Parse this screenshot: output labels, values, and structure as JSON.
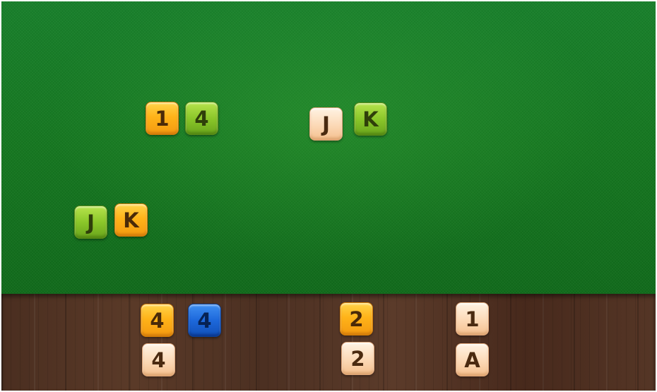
{
  "table": {
    "melds": [
      {
        "tiles": [
          {
            "label": "1",
            "color": "orange"
          },
          {
            "label": "4",
            "color": "green"
          }
        ]
      },
      {
        "tiles": [
          {
            "label": "J",
            "color": "cream"
          },
          {
            "label": "K",
            "color": "green"
          }
        ]
      },
      {
        "tiles": [
          {
            "label": "J",
            "color": "green"
          },
          {
            "label": "K",
            "color": "orange"
          }
        ]
      }
    ]
  },
  "rack": {
    "tiles": [
      {
        "label": "4",
        "color": "orange"
      },
      {
        "label": "4",
        "color": "blue"
      },
      {
        "label": "4",
        "color": "cream"
      },
      {
        "label": "2",
        "color": "orange"
      },
      {
        "label": "2",
        "color": "cream"
      },
      {
        "label": "1",
        "color": "cream"
      },
      {
        "label": "A",
        "color": "cream"
      }
    ]
  },
  "colors": {
    "orange": "#ffb319",
    "green": "#8bc72a",
    "cream": "#fcd9b6",
    "blue": "#1d68db",
    "felt": "#14771f",
    "wood": "#4f3224"
  }
}
